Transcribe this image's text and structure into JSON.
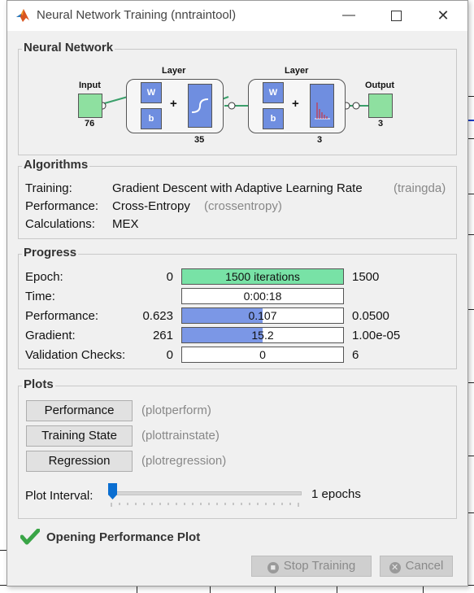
{
  "window": {
    "title": "Neural Network Training (nntraintool)"
  },
  "network": {
    "section_title": "Neural Network",
    "input_label": "Input",
    "input_size": "76",
    "hidden_layer_label": "Layer",
    "hidden_size": "35",
    "output_layer_label": "Layer",
    "output_layer_size": "3",
    "output_label": "Output",
    "output_size": "3",
    "w_label": "W",
    "b_label": "b",
    "plus": "+"
  },
  "algorithms": {
    "section_title": "Algorithms",
    "rows": [
      {
        "label": "Training:",
        "value": "Gradient Descent with Adaptive Learning Rate",
        "func": "(traingda)"
      },
      {
        "label": "Performance:",
        "value": "Cross-Entropy",
        "func": "(crossentropy)"
      },
      {
        "label": "Calculations:",
        "value": "MEX",
        "func": ""
      }
    ]
  },
  "progress": {
    "section_title": "Progress",
    "rows": [
      {
        "label": "Epoch:",
        "start": "0",
        "bar_text": "1500 iterations",
        "end": "1500",
        "fill": 1.0,
        "color": "#78e2a6"
      },
      {
        "label": "Time:",
        "start": "",
        "bar_text": "0:00:18",
        "end": "",
        "fill": 0,
        "color": "#7b97e6"
      },
      {
        "label": "Performance:",
        "start": "0.623",
        "bar_text": "0.107",
        "end": "0.0500",
        "fill": 0.5,
        "color": "#7b97e6"
      },
      {
        "label": "Gradient:",
        "start": "261",
        "bar_text": "15.2",
        "end": "1.00e-05",
        "fill": 0.5,
        "color": "#7b97e6"
      },
      {
        "label": "Validation Checks:",
        "start": "0",
        "bar_text": "0",
        "end": "6",
        "fill": 0,
        "color": "#7b97e6"
      }
    ]
  },
  "plots": {
    "section_title": "Plots",
    "buttons": [
      {
        "label": "Performance",
        "func": "(plotperform)"
      },
      {
        "label": "Training State",
        "func": "(plottrainstate)"
      },
      {
        "label": "Regression",
        "func": "(plotregression)"
      }
    ],
    "interval_label": "Plot Interval:",
    "interval_value": "1 epochs",
    "slider_level": 0
  },
  "status": {
    "text": "Opening Performance Plot"
  },
  "footer": {
    "stop_label": "Stop Training",
    "cancel_label": "Cancel"
  }
}
